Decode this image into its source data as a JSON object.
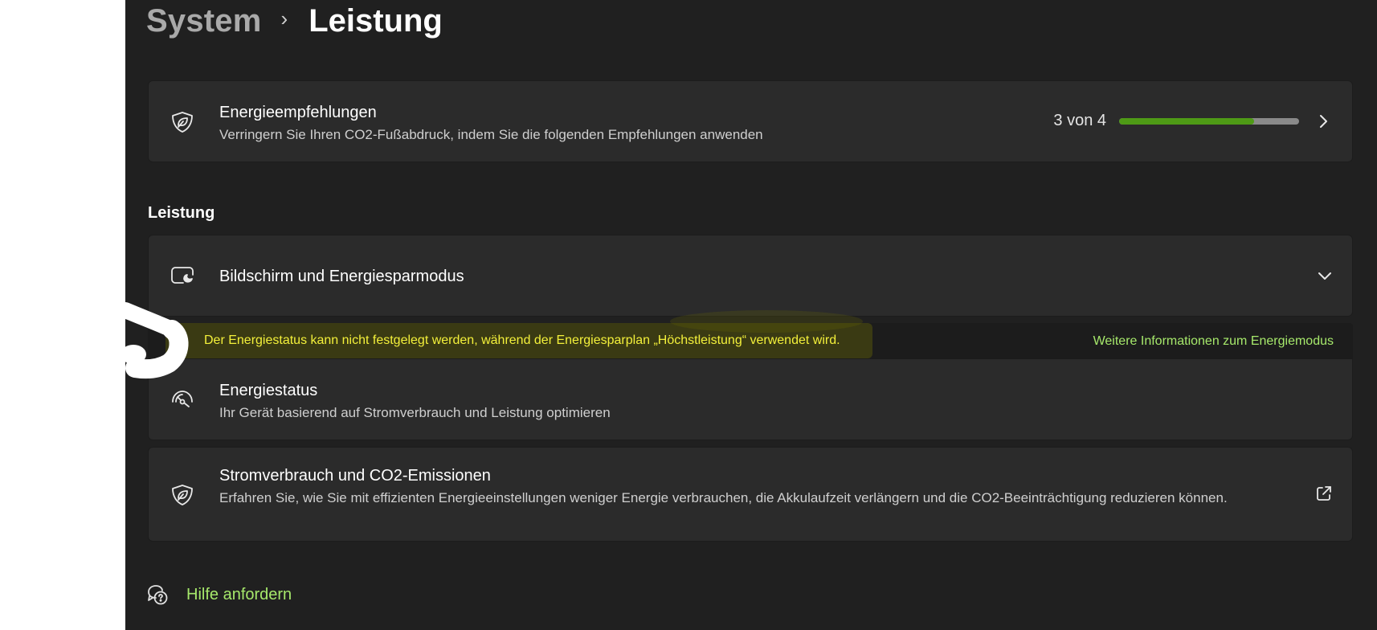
{
  "breadcrumb": {
    "parent": "System",
    "separator": "›",
    "current": "Leistung"
  },
  "recommendations": {
    "title": "Energieempfehlungen",
    "description": "Verringern Sie Ihren CO2-Fußabdruck, indem Sie die folgenden Empfehlungen anwenden",
    "progress_text": "3 von 4",
    "progress_fraction": 0.75,
    "icon": "leaf-shield-icon"
  },
  "section": {
    "heading": "Leistung"
  },
  "screen_sleep": {
    "title": "Bildschirm und Energiesparmodus",
    "icon": "screen-moon-icon"
  },
  "info_bar": {
    "message": "Der Energiestatus kann nicht festgelegt werden, während der Energiesparplan „Höchstleistung“ verwendet wird.",
    "link": "Weitere Informationen zum Energiemodus"
  },
  "power_mode": {
    "title": "Energiestatus",
    "description": "Ihr Gerät basierend auf Stromverbrauch und Leistung optimieren",
    "icon": "gauge-icon"
  },
  "consumption": {
    "title": "Stromverbrauch und CO2-Emissionen",
    "description": "Erfahren Sie, wie Sie mit effizienten Energieeinstellungen weniger Energie verbrauchen, die Akkulaufzeit verlängern und die CO2-Beeinträchtigung reduzieren können.",
    "icon": "leaf-shield-icon"
  },
  "help": {
    "label": "Hilfe anfordern",
    "icon": "help-chat-icon"
  },
  "colors": {
    "background": "#202020",
    "card": "#2b2b2b",
    "accent_green": "#4e9a16",
    "link_green": "#a6e86b",
    "highlight_text": "#f3f03a"
  }
}
